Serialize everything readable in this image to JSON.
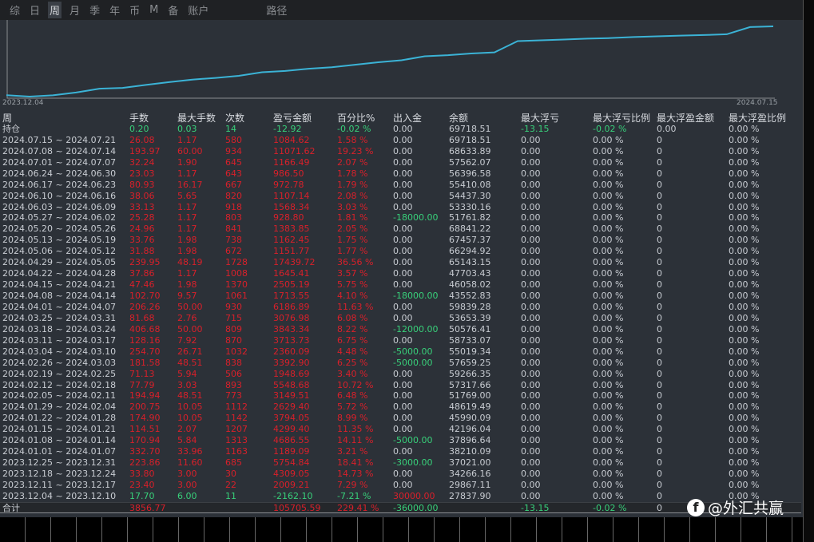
{
  "tabs": [
    "综",
    "日",
    "周",
    "月",
    "季",
    "年",
    "币",
    "M",
    "备",
    "账户"
  ],
  "active_tab": 2,
  "path_label": "路径",
  "chart": {
    "start_date": "2023.12.04",
    "end_date": "2024.07.15",
    "line_color": "#3bb3d6"
  },
  "headers": [
    "周",
    "手数",
    "最大手数",
    "次数",
    "盈亏金额",
    "百分比%",
    "出入金",
    "余额",
    "最大浮亏",
    "最大浮亏比例",
    "最大浮盈金额",
    "最大浮盈比例"
  ],
  "holding": [
    "持仓",
    "0.20",
    "0.03",
    "14",
    "-12.92",
    "-0.02 %",
    "0.00",
    "69718.51",
    "-13.15",
    "-0.02 %",
    "0.00",
    "0.00 %"
  ],
  "rows": [
    [
      "2024.07.15 ~ 2024.07.21",
      "26.08",
      "1.17",
      "580",
      "1084.62",
      "1.58 %",
      "0.00",
      "69718.51"
    ],
    [
      "2024.07.08 ~ 2024.07.14",
      "193.97",
      "60.00",
      "934",
      "11071.62",
      "19.23 %",
      "0.00",
      "68633.89"
    ],
    [
      "2024.07.01 ~ 2024.07.07",
      "32.24",
      "1.90",
      "645",
      "1166.49",
      "2.07 %",
      "0.00",
      "57562.07"
    ],
    [
      "2024.06.24 ~ 2024.06.30",
      "23.03",
      "1.17",
      "643",
      "986.50",
      "1.78 %",
      "0.00",
      "56396.58"
    ],
    [
      "2024.06.17 ~ 2024.06.23",
      "80.93",
      "16.17",
      "667",
      "972.78",
      "1.79 %",
      "0.00",
      "55410.08"
    ],
    [
      "2024.06.10 ~ 2024.06.16",
      "38.06",
      "5.65",
      "820",
      "1107.14",
      "2.08 %",
      "0.00",
      "54437.30"
    ],
    [
      "2024.06.03 ~ 2024.06.09",
      "33.13",
      "1.17",
      "918",
      "1568.34",
      "3.03 %",
      "0.00",
      "53330.16"
    ],
    [
      "2024.05.27 ~ 2024.06.02",
      "25.28",
      "1.17",
      "803",
      "928.80",
      "1.81 %",
      "-18000.00",
      "51761.82"
    ],
    [
      "2024.05.20 ~ 2024.05.26",
      "24.96",
      "1.17",
      "841",
      "1383.85",
      "2.05 %",
      "0.00",
      "68841.22"
    ],
    [
      "2024.05.13 ~ 2024.05.19",
      "33.76",
      "1.98",
      "738",
      "1162.45",
      "1.75 %",
      "0.00",
      "67457.37"
    ],
    [
      "2024.05.06 ~ 2024.05.12",
      "31.88",
      "1.98",
      "672",
      "1151.77",
      "1.77 %",
      "0.00",
      "66294.92"
    ],
    [
      "2024.04.29 ~ 2024.05.05",
      "239.95",
      "48.19",
      "1728",
      "17439.72",
      "36.56 %",
      "0.00",
      "65143.15"
    ],
    [
      "2024.04.22 ~ 2024.04.28",
      "37.86",
      "1.17",
      "1008",
      "1645.41",
      "3.57 %",
      "0.00",
      "47703.43"
    ],
    [
      "2024.04.15 ~ 2024.04.21",
      "47.46",
      "1.98",
      "1370",
      "2505.19",
      "5.75 %",
      "0.00",
      "46058.02"
    ],
    [
      "2024.04.08 ~ 2024.04.14",
      "102.70",
      "9.57",
      "1061",
      "1713.55",
      "4.10 %",
      "-18000.00",
      "43552.83"
    ],
    [
      "2024.04.01 ~ 2024.04.07",
      "206.26",
      "50.00",
      "930",
      "6186.89",
      "11.63 %",
      "0.00",
      "59839.28"
    ],
    [
      "2024.03.25 ~ 2024.03.31",
      "81.68",
      "2.76",
      "715",
      "3076.98",
      "6.08 %",
      "0.00",
      "53653.39"
    ],
    [
      "2024.03.18 ~ 2024.03.24",
      "406.68",
      "50.00",
      "809",
      "3843.34",
      "8.22 %",
      "-12000.00",
      "50576.41"
    ],
    [
      "2024.03.11 ~ 2024.03.17",
      "128.16",
      "7.92",
      "870",
      "3713.73",
      "6.75 %",
      "0.00",
      "58733.07"
    ],
    [
      "2024.03.04 ~ 2024.03.10",
      "254.70",
      "26.71",
      "1032",
      "2360.09",
      "4.48 %",
      "-5000.00",
      "55019.34"
    ],
    [
      "2024.02.26 ~ 2024.03.03",
      "181.58",
      "48.51",
      "838",
      "3392.90",
      "6.25 %",
      "-5000.00",
      "57659.25"
    ],
    [
      "2024.02.19 ~ 2024.02.25",
      "71.13",
      "5.94",
      "506",
      "1948.69",
      "3.40 %",
      "0.00",
      "59266.35"
    ],
    [
      "2024.02.12 ~ 2024.02.18",
      "77.79",
      "3.03",
      "893",
      "5548.68",
      "10.72 %",
      "0.00",
      "57317.66"
    ],
    [
      "2024.02.05 ~ 2024.02.11",
      "194.94",
      "48.51",
      "773",
      "3149.51",
      "6.48 %",
      "0.00",
      "51769.00"
    ],
    [
      "2024.01.29 ~ 2024.02.04",
      "200.75",
      "10.05",
      "1112",
      "2629.40",
      "5.72 %",
      "0.00",
      "48619.49"
    ],
    [
      "2024.01.22 ~ 2024.01.28",
      "174.90",
      "10.05",
      "1142",
      "3794.05",
      "8.99 %",
      "0.00",
      "45990.09"
    ],
    [
      "2024.01.15 ~ 2024.01.21",
      "114.51",
      "2.07",
      "1207",
      "4299.40",
      "11.35 %",
      "0.00",
      "42196.04"
    ],
    [
      "2024.01.08 ~ 2024.01.14",
      "170.94",
      "5.84",
      "1313",
      "4686.55",
      "14.11 %",
      "-5000.00",
      "37896.64"
    ],
    [
      "2024.01.01 ~ 2024.01.07",
      "332.70",
      "33.96",
      "1163",
      "1189.09",
      "3.21 %",
      "0.00",
      "38210.09"
    ],
    [
      "2023.12.25 ~ 2023.12.31",
      "223.86",
      "11.60",
      "685",
      "5754.84",
      "18.41 %",
      "-3000.00",
      "37021.00"
    ],
    [
      "2023.12.18 ~ 2023.12.24",
      "33.80",
      "3.00",
      "30",
      "4309.05",
      "14.73 %",
      "0.00",
      "34266.16"
    ],
    [
      "2023.12.11 ~ 2023.12.17",
      "23.40",
      "3.00",
      "22",
      "2009.21",
      "7.29 %",
      "0.00",
      "29867.11"
    ],
    [
      "2023.12.04 ~ 2023.12.10",
      "17.70",
      "6.00",
      "11",
      "-2162.10",
      "-7.21 %",
      "30000.00",
      "27837.90"
    ]
  ],
  "row_tail": [
    "0.00",
    "0.00 %",
    "0",
    "0.00 %"
  ],
  "total": [
    "合计",
    "3856.77",
    "",
    "",
    "105705.59",
    "229.41 %",
    "-36000.00",
    "",
    "-13.15",
    "-0.02 %",
    "0",
    ""
  ],
  "watermark": "@外汇共赢",
  "watermark_icon": "f"
}
